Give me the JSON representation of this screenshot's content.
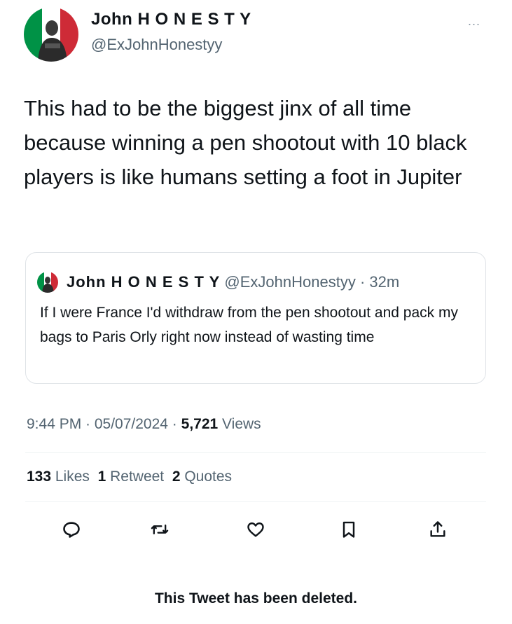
{
  "author": {
    "display_name": "John H O N E S T Y",
    "handle": "@ExJohnHonestyy"
  },
  "more_menu": "...",
  "tweet": {
    "text": "This had to be the biggest jinx of all time because winning a pen shootout with 10 black players is like humans setting a foot in Jupiter"
  },
  "quoted_tweet": {
    "display_name": "John H O N E S T Y",
    "meta": " @ExJohnHonestyy · 32m",
    "text": "If I were France I'd withdraw from the pen shootout and pack my bags to Paris Orly right now instead of wasting time"
  },
  "timestamp": {
    "time_date": "9:44 PM · 05/07/2024 · ",
    "views_count": "5,721",
    "views_label": " Views"
  },
  "stats": {
    "likes_count": "133",
    "likes_label": " Likes  ",
    "retweets_count": "1",
    "retweets_label": " Retweet  ",
    "quotes_count": "2",
    "quotes_label": " Quotes"
  },
  "actions": {
    "reply_icon": "reply-icon",
    "retweet_icon": "retweet-icon",
    "like_icon": "heart-icon",
    "bookmark_icon": "bookmark-icon",
    "share_icon": "share-icon"
  },
  "deleted_notice": "This Tweet has been deleted.",
  "colors": {
    "text_primary": "#0f1419",
    "text_secondary": "#536471",
    "border": "#dfe3e7",
    "italy_green": "#009246",
    "italy_red": "#ce2b37"
  }
}
